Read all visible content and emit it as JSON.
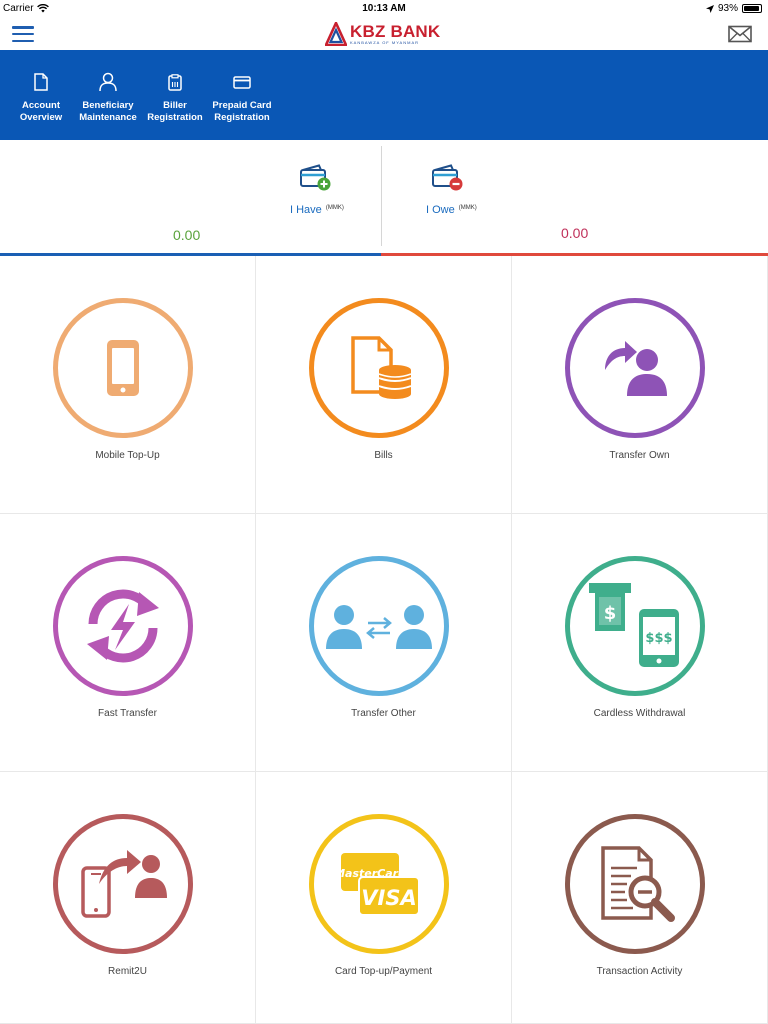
{
  "status_bar": {
    "carrier": "Carrier",
    "time": "10:13 AM",
    "battery": "93%",
    "battery_level": 0.93
  },
  "header": {
    "logo_name": "KBZ BANK",
    "logo_tagline": "KANBAWZA OF MYANMAR",
    "brand_red": "#c8202f",
    "brand_blue": "#0a57b5"
  },
  "quick_actions": [
    {
      "label": "Account\nOverview",
      "icon": "document-icon"
    },
    {
      "label": "Beneficiary\nMaintenance",
      "icon": "person-icon"
    },
    {
      "label": "Biller\nRegistration",
      "icon": "clipboard-icon"
    },
    {
      "label": "Prepaid Card\nRegistration",
      "icon": "card-icon"
    }
  ],
  "balances": {
    "have": {
      "label": "I Have",
      "currency": "(MMK)",
      "value": "0.00",
      "color": "#5aa33c"
    },
    "owe": {
      "label": "I Owe",
      "currency": "(MMK)",
      "value": "0.00",
      "color": "#c0305a"
    }
  },
  "services": [
    {
      "label": "Mobile Top-Up",
      "icon": "mobile-phone-icon",
      "color": "#efab72"
    },
    {
      "label": "Bills",
      "icon": "bills-icon",
      "color": "#f38b1e"
    },
    {
      "label": "Transfer Own",
      "icon": "transfer-own-icon",
      "color": "#8e53b6"
    },
    {
      "label": "Fast Transfer",
      "icon": "fast-transfer-icon",
      "color": "#b657b4"
    },
    {
      "label": "Transfer Other",
      "icon": "transfer-other-icon",
      "color": "#5fb1de"
    },
    {
      "label": "Cardless Withdrawal",
      "icon": "cardless-withdrawal-icon",
      "color": "#3fae8c"
    },
    {
      "label": "Remit2U",
      "icon": "remit-icon",
      "color": "#b65a5c"
    },
    {
      "label": "Card Top-up/Payment",
      "icon": "card-payment-icon",
      "color": "#f3c319"
    },
    {
      "label": "Transaction Activity",
      "icon": "transaction-activity-icon",
      "color": "#8b5a4e"
    }
  ]
}
